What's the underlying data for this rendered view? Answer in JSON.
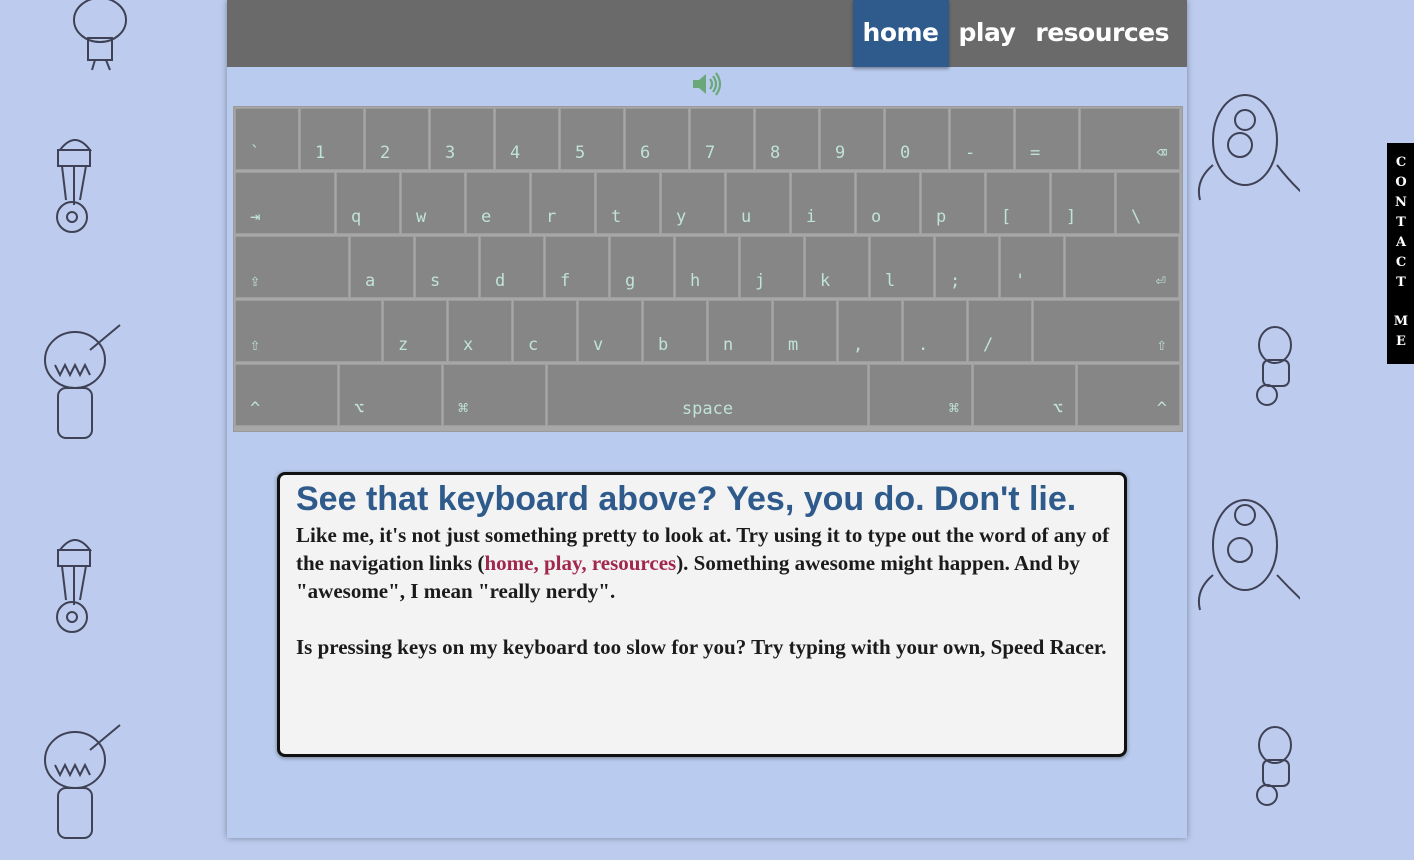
{
  "nav": {
    "items": [
      {
        "label": "home",
        "active": true
      },
      {
        "label": "play",
        "active": false
      },
      {
        "label": "resources",
        "active": false
      }
    ]
  },
  "sound": {
    "icon": "speaker-icon",
    "color": "#6aa87a"
  },
  "keyboard": {
    "rows": [
      [
        "`",
        "1",
        "2",
        "3",
        "4",
        "5",
        "6",
        "7",
        "8",
        "9",
        "0",
        "-",
        "=",
        "⌫"
      ],
      [
        "⇥",
        "q",
        "w",
        "e",
        "r",
        "t",
        "y",
        "u",
        "i",
        "o",
        "p",
        "[",
        "]",
        "\\"
      ],
      [
        "⇪",
        "a",
        "s",
        "d",
        "f",
        "g",
        "h",
        "j",
        "k",
        "l",
        ";",
        "'",
        "⏎"
      ],
      [
        "⇧",
        "z",
        "x",
        "c",
        "v",
        "b",
        "n",
        "m",
        ",",
        ".",
        "/",
        "⇧"
      ],
      [
        "^",
        "⌥",
        "⌘",
        "space",
        "⌘",
        "⌥",
        "^"
      ]
    ],
    "key_color": "#868686",
    "label_color": "#bfe3d4"
  },
  "card": {
    "title": "See that keyboard above? Yes, you do. Don't lie.",
    "para1_before": "Like me, it's not just something pretty to look at. Try using it to type out the word of any of the navigation links (",
    "para1_links": "home, play, resources",
    "para1_after": "). Something awesome might happen. And by \"awesome\", I mean \"really nerdy\".",
    "para2": "Is pressing keys on my keyboard too slow for you? Try typing with your own, Speed Racer.",
    "title_color": "#2e5b8c",
    "link_color": "#a2274d"
  },
  "contact": {
    "word1": [
      "C",
      "O",
      "N",
      "T",
      "A",
      "C",
      "T"
    ],
    "word2": [
      "M",
      "E"
    ]
  }
}
